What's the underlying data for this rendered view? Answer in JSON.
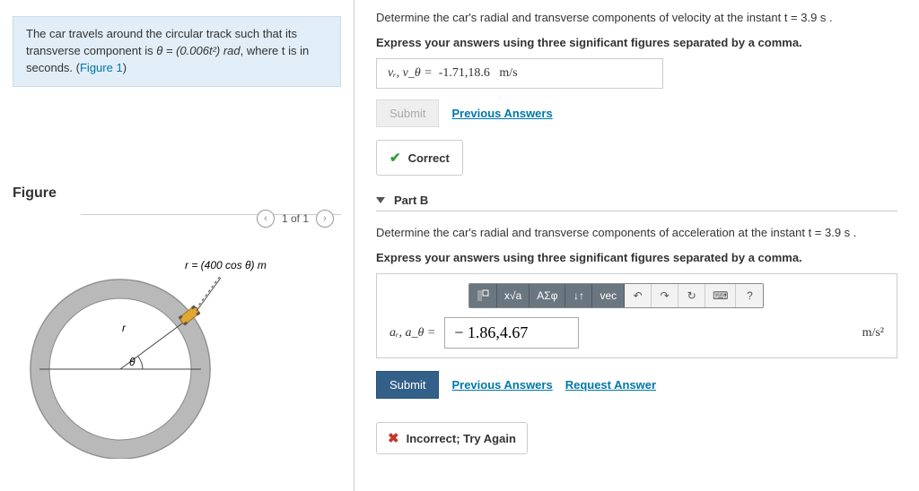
{
  "problem": {
    "text_prefix": "The car travels around the circular track such that its transverse component is ",
    "formula": "θ = (0.006t²) rad",
    "text_mid": ", where t is in seconds. (",
    "figure_link": "Figure 1",
    "text_suffix": ")"
  },
  "figure": {
    "heading": "Figure",
    "nav_label": "1 of 1",
    "prev": "‹",
    "next": "›",
    "r_formula": "r = (400 cos θ) m",
    "r_label": "r",
    "theta_label": "θ"
  },
  "partA": {
    "prompt": "Determine the car's radial and transverse components of velocity at the instant t = 3.9  s .",
    "instruction": "Express your answers using three significant figures separated by a comma.",
    "var_label": "vᵣ, v_θ =",
    "value": "-1.71,18.6",
    "unit": "m/s",
    "submit": "Submit",
    "prev_answers": "Previous Answers",
    "correct": "Correct"
  },
  "partB": {
    "header": "Part B",
    "prompt": "Determine the car's radial and transverse components of acceleration at the instant t = 3.9  s .",
    "instruction": "Express your answers using three significant figures separated by a comma.",
    "toolbar": {
      "templates": "x√a",
      "greek": "ΑΣφ",
      "updown": "↓↑",
      "vec": "vec",
      "undo": "↶",
      "redo": "↷",
      "reset": "↻",
      "keyboard": "⌨",
      "help": "?"
    },
    "var_label": "aᵣ, a_θ =",
    "value": "− 1.86,4.67",
    "unit": "m/s²",
    "submit": "Submit",
    "prev_answers": "Previous Answers",
    "request_answer": "Request Answer",
    "incorrect": "Incorrect; Try Again"
  }
}
